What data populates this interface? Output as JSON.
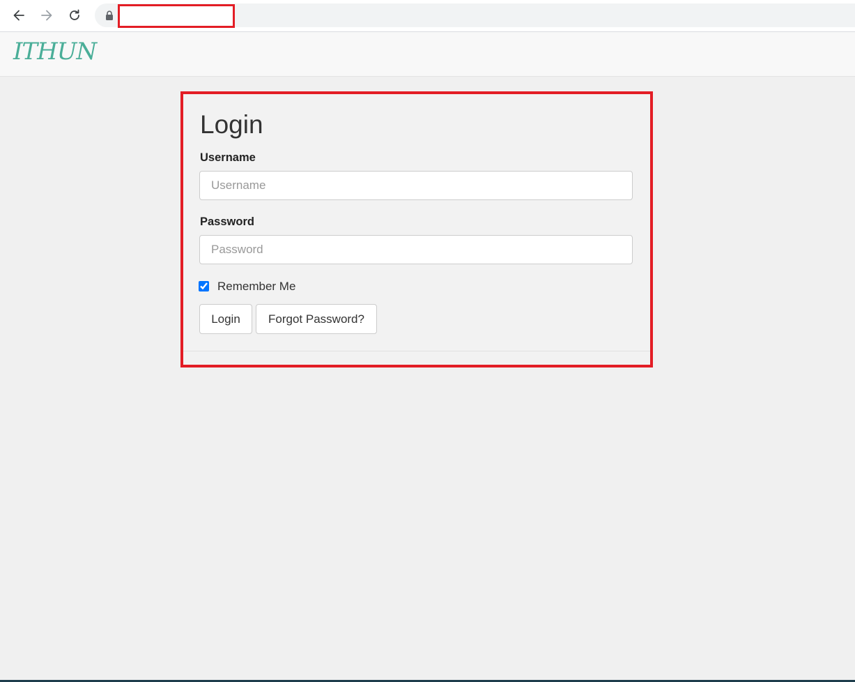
{
  "browser": {
    "back_icon": "arrow-left-icon",
    "forward_icon": "arrow-right-icon",
    "reload_icon": "reload-icon",
    "lock_icon": "lock-icon"
  },
  "navbar": {
    "brand": "ITHUN",
    "brand_color": "#4aae98"
  },
  "login": {
    "title": "Login",
    "username_label": "Username",
    "username_placeholder": "Username",
    "username_value": "",
    "password_label": "Password",
    "password_placeholder": "Password",
    "password_value": "",
    "remember_label": "Remember Me",
    "remember_checked": true,
    "login_button": "Login",
    "forgot_button": "Forgot Password?"
  },
  "annotations": {
    "highlight_color": "#e31d25"
  }
}
